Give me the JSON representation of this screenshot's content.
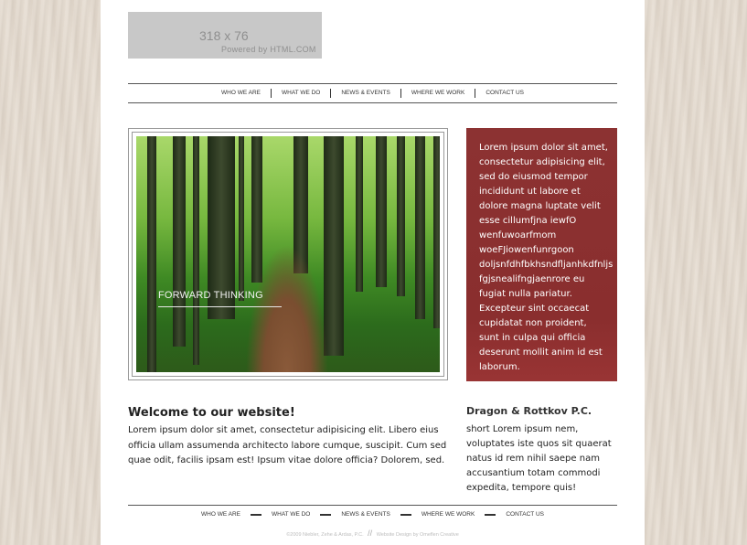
{
  "logo": {
    "dimensions": "318 x 76",
    "powered_by": "Powered by HTML.COM"
  },
  "nav": {
    "items": [
      "WHO WE ARE",
      "WHAT WE DO",
      "NEWS & EVENTS",
      "WHERE WE WORK",
      "CONTACT US"
    ]
  },
  "hero": {
    "caption": "FORWARD THINKING"
  },
  "aside": {
    "text": "Lorem ipsum dolor sit amet, consectetur adipisicing elit, sed do eiusmod tempor incididunt ut labore et dolore magna luptate velit esse cillumfjna iewfO wenfuwoarfmom woeFJiowenfunrgoon doljsnfdhfbkhsndfljanhkdfnljs fgjsnealifngjaenrore eu fugiat nulla pariatur. Excepteur sint occaecat cupidatat non proident, sunt in culpa qui officia deserunt mollit anim id est laborum."
  },
  "welcome": {
    "title": "Welcome to our website!",
    "text": "Lorem ipsum dolor sit amet, consectetur adipisicing elit. Libero eius officia ullam assumenda architecto labore cumque, suscipit. Cum sed quae odit, facilis ipsam est! Ipsum vitae dolore officia? Dolorem, sed."
  },
  "company": {
    "title": "Dragon & Rottkov P.C.",
    "text": "short Lorem ipsum nem, voluptates iste quos sit quaerat natus id rem nihil saepe nam accusantium totam commodi expedita, tempore quis!"
  },
  "footer": {
    "nav": [
      "WHO WE ARE",
      "WHAT WE DO",
      "NEWS & EVENTS",
      "WHERE WE WORK",
      "CONTACT US"
    ],
    "copyright": "©2009 Niebler, Zehe & Ardas, P.C.",
    "design_credit": "Website Design by Omeflen Creative"
  }
}
